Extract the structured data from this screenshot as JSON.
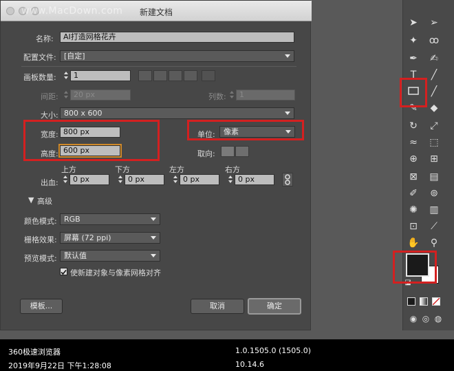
{
  "window": {
    "title": "新建文档",
    "watermark": "www.MacDown.com"
  },
  "form": {
    "name_label": "名称:",
    "name_value": "AI打造网格花卉",
    "profile_label": "配置文件:",
    "profile_value": "[自定]",
    "artboards_label": "画板数量:",
    "artboards_value": "1",
    "spacing_label": "间距:",
    "spacing_value": "20 px",
    "columns_label": "列数:",
    "columns_value": "1",
    "size_label": "大小:",
    "size_value": "800 x 600",
    "width_label": "宽度:",
    "width_value": "800 px",
    "height_label": "高度:",
    "height_value": "600 px",
    "units_label": "单位:",
    "units_value": "像素",
    "orientation_label": "取向:",
    "bleed_label": "出血:",
    "bleed_top_label": "上方",
    "bleed_bottom_label": "下方",
    "bleed_left_label": "左方",
    "bleed_right_label": "右方",
    "bleed_top": "0 px",
    "bleed_bottom": "0 px",
    "bleed_left": "0 px",
    "bleed_right": "0 px"
  },
  "advanced": {
    "toggle_label": "高级",
    "color_mode_label": "颜色模式:",
    "color_mode_value": "RGB",
    "raster_label": "栅格效果:",
    "raster_value": "屏幕 (72 ppi)",
    "preview_label": "预览模式:",
    "preview_value": "默认值",
    "align_checkbox_label": "使新建对象与像素网格对齐",
    "align_checked": true
  },
  "buttons": {
    "templates": "模板...",
    "cancel": "取消",
    "ok": "确定"
  },
  "footer": {
    "app": "360极速浏览器",
    "version": "1.0.1505.0 (1505.0)",
    "date": "2019年9月22日 下午1:28:08",
    "os": "10.14.6"
  },
  "colors": {
    "highlight": "#d42020",
    "dialog_bg": "#474747",
    "field_bg": "#bdbdbd"
  }
}
